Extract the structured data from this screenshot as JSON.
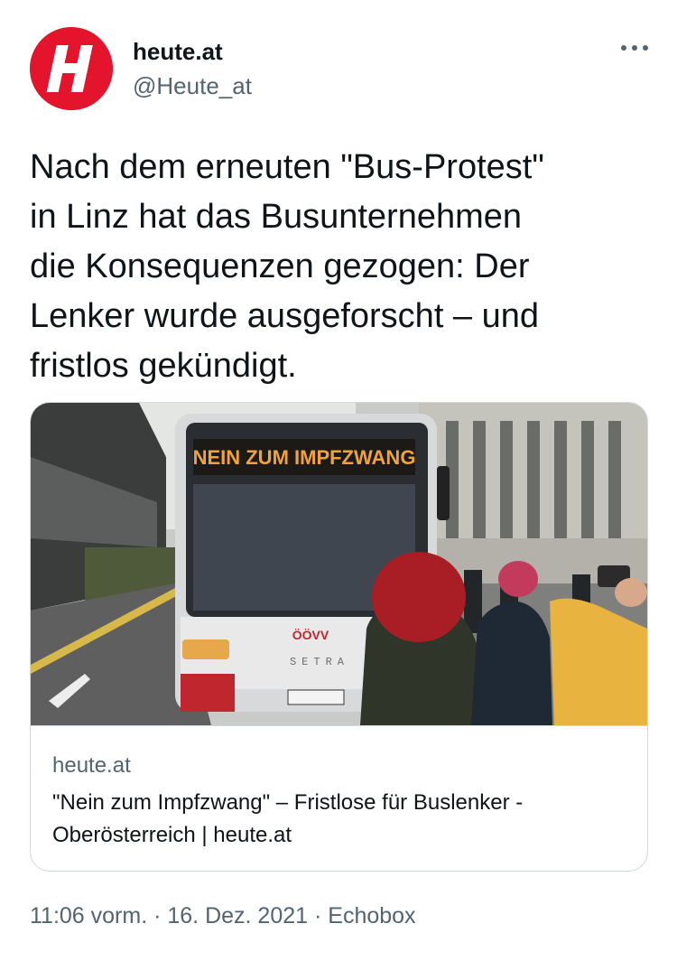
{
  "account": {
    "name": "heute.at",
    "handle": "@Heute_at",
    "avatar_letter": "H",
    "avatar_color": "#e3142b"
  },
  "tweet": {
    "text": "Nach dem erneuten \"Bus-Protest\"\nin Linz hat das Busunternehmen\ndie Konsequenzen gezogen: Der\nLenker wurde ausgeforscht – und\nfristlos gekündigt."
  },
  "card": {
    "image_sign_text": "NEIN ZUM IMPFZWANG",
    "image_bus_brand": "ÖÖVV",
    "image_bus_maker": "SETRA",
    "domain": "heute.at",
    "title": "\"Nein zum Impfzwang\" – Fristlose für Buslenker - Oberösterreich | heute.at"
  },
  "meta": {
    "time": "11:06 vorm.",
    "separator1": " · ",
    "date": "16. Dez. 2021",
    "separator2": " · ",
    "source": "Echobox"
  },
  "icons": {
    "more": "more-horizontal-icon"
  }
}
